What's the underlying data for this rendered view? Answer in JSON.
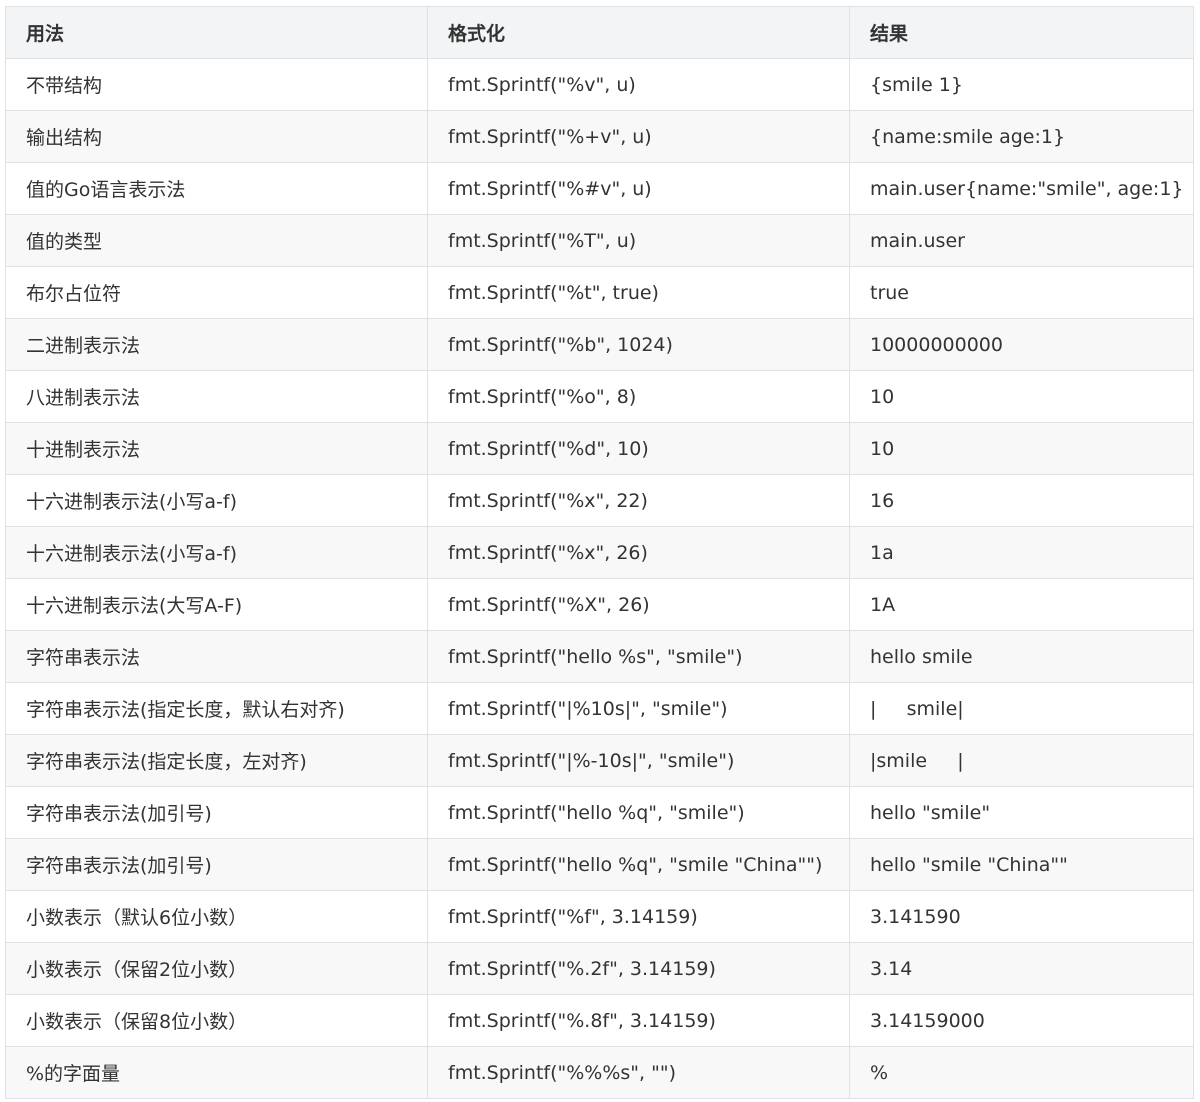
{
  "table": {
    "headers": [
      "用法",
      "格式化",
      "结果"
    ],
    "rows": [
      {
        "usage": "不带结构",
        "format": "fmt.Sprintf(\"%v\", u)",
        "result": "{smile 1}"
      },
      {
        "usage": "输出结构",
        "format": "fmt.Sprintf(\"%+v\", u)",
        "result": "{name:smile age:1}"
      },
      {
        "usage": "值的Go语言表示法",
        "format": "fmt.Sprintf(\"%#v\", u)",
        "result": "main.user{name:\"smile\", age:1}"
      },
      {
        "usage": "值的类型",
        "format": "fmt.Sprintf(\"%T\", u)",
        "result": "main.user"
      },
      {
        "usage": "布尔占位符",
        "format": "fmt.Sprintf(\"%t\", true)",
        "result": "true"
      },
      {
        "usage": "二进制表示法",
        "format": "fmt.Sprintf(\"%b\", 1024)",
        "result": "10000000000"
      },
      {
        "usage": "八进制表示法",
        "format": "fmt.Sprintf(\"%o\", 8)",
        "result": "10"
      },
      {
        "usage": "十进制表示法",
        "format": "fmt.Sprintf(\"%d\", 10)",
        "result": "10"
      },
      {
        "usage": "十六进制表示法(小写a-f)",
        "format": "fmt.Sprintf(\"%x\", 22)",
        "result": "16"
      },
      {
        "usage": "十六进制表示法(小写a-f)",
        "format": "fmt.Sprintf(\"%x\", 26)",
        "result": "1a"
      },
      {
        "usage": "十六进制表示法(大写A-F)",
        "format": "fmt.Sprintf(\"%X\", 26)",
        "result": "1A"
      },
      {
        "usage": "字符串表示法",
        "format": "fmt.Sprintf(\"hello %s\", \"smile\")",
        "result": "hello smile"
      },
      {
        "usage": "字符串表示法(指定长度，默认右对齐)",
        "format": "fmt.Sprintf(\"|%10s|\", \"smile\")",
        "result": "|     smile|"
      },
      {
        "usage": "字符串表示法(指定长度，左对齐)",
        "format": "fmt.Sprintf(\"|%-10s|\", \"smile\")",
        "result": "|smile     |"
      },
      {
        "usage": "字符串表示法(加引号)",
        "format": "fmt.Sprintf(\"hello %q\", \"smile\")",
        "result": "hello \"smile\""
      },
      {
        "usage": "字符串表示法(加引号)",
        "format": "fmt.Sprintf(\"hello %q\", \"smile \"China\"\")",
        "result": "hello \"smile \"China\"\""
      },
      {
        "usage": "小数表示（默认6位小数）",
        "format": "fmt.Sprintf(\"%f\", 3.14159)",
        "result": "3.141590"
      },
      {
        "usage": "小数表示（保留2位小数）",
        "format": "fmt.Sprintf(\"%.2f\", 3.14159)",
        "result": "3.14"
      },
      {
        "usage": "小数表示（保留8位小数）",
        "format": "fmt.Sprintf(\"%.8f\", 3.14159)",
        "result": "3.14159000"
      },
      {
        "usage": "%的字面量",
        "format": "fmt.Sprintf(\"%%%s\", \"\")",
        "result": "%"
      }
    ]
  },
  "colors": {
    "header_bg": "#f3f4f6",
    "border": "#dfe2e5",
    "stripe": "#f8f8f8",
    "text": "#333333"
  }
}
